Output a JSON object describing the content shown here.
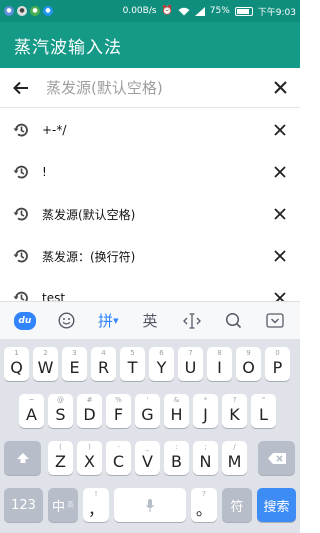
{
  "status_bar": {
    "network_speed": "0.00B/s",
    "battery_percent": "75%",
    "time": "下午9:03",
    "icons": [
      "notification-icon",
      "app-icon",
      "alarm-icon",
      "wifi-icon",
      "signal-icon",
      "battery-icon"
    ]
  },
  "app_bar": {
    "title": "蒸汽波输入法"
  },
  "search": {
    "placeholder": "蒸发源(默认空格)"
  },
  "history": {
    "items": [
      {
        "text": "+-*/"
      },
      {
        "text": "!"
      },
      {
        "text": "蒸发源(默认空格)"
      },
      {
        "text": "蒸发源：(换行符)"
      },
      {
        "text": "test"
      }
    ]
  },
  "keyboard_toolbar": {
    "logo": "du",
    "pinyin_label": "拼",
    "english_label": "英",
    "icons": [
      "emoji-icon",
      "cursor-icon",
      "search-icon",
      "collapse-keyboard-icon"
    ]
  },
  "keyboard": {
    "row1": [
      {
        "key": "Q",
        "hint": "1"
      },
      {
        "key": "W",
        "hint": "2"
      },
      {
        "key": "E",
        "hint": "3"
      },
      {
        "key": "R",
        "hint": "4"
      },
      {
        "key": "T",
        "hint": "5"
      },
      {
        "key": "Y",
        "hint": "6"
      },
      {
        "key": "U",
        "hint": "7"
      },
      {
        "key": "I",
        "hint": "8"
      },
      {
        "key": "O",
        "hint": "9"
      },
      {
        "key": "P",
        "hint": "0"
      }
    ],
    "row2": [
      {
        "key": "A",
        "hint": "~"
      },
      {
        "key": "S",
        "hint": "@"
      },
      {
        "key": "D",
        "hint": "#"
      },
      {
        "key": "F",
        "hint": "%"
      },
      {
        "key": "G",
        "hint": "'"
      },
      {
        "key": "H",
        "hint": "&"
      },
      {
        "key": "J",
        "hint": "*"
      },
      {
        "key": "K",
        "hint": "?"
      },
      {
        "key": "L",
        "hint": "\""
      }
    ],
    "row3": [
      {
        "key": "Z",
        "hint": "("
      },
      {
        "key": "X",
        "hint": ")"
      },
      {
        "key": "C",
        "hint": "-"
      },
      {
        "key": "V",
        "hint": "_"
      },
      {
        "key": "B",
        "hint": ":"
      },
      {
        "key": "N",
        "hint": ";"
      },
      {
        "key": "M",
        "hint": "/"
      }
    ],
    "bottom": {
      "num_label": "123",
      "lang_label": "中",
      "lang_hint": "英",
      "comma_label": "，",
      "comma_hint": "!",
      "period_label": "。",
      "period_hint": "?",
      "symbol_label": "符",
      "search_label": "搜索"
    }
  }
}
